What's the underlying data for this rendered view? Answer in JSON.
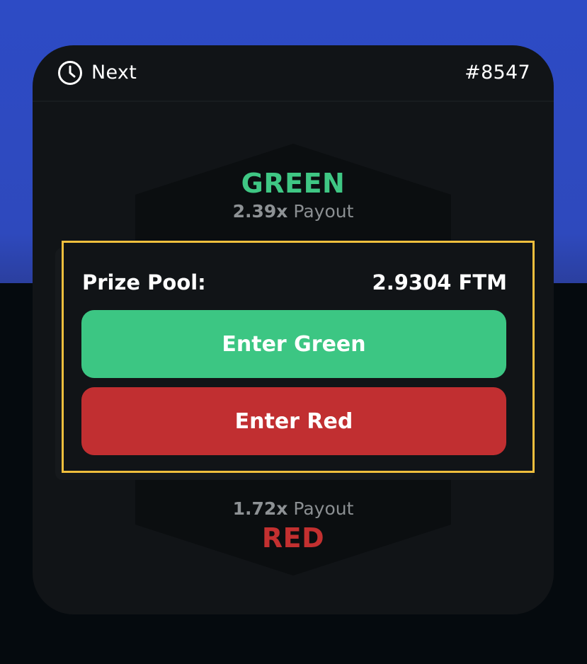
{
  "header": {
    "status_label": "Next",
    "round_id": "#8547",
    "status_icon": "clock-icon"
  },
  "green": {
    "title": "GREEN",
    "multiplier": "2.39x",
    "payout_label": "Payout",
    "color": "#3fc784"
  },
  "red": {
    "title": "RED",
    "multiplier": "1.72x",
    "payout_label": "Payout",
    "color": "#c33030"
  },
  "panel": {
    "prize_label": "Prize Pool:",
    "prize_value": "2.9304 FTM",
    "border_color": "#f0bf3d",
    "enter_green_label": "Enter Green",
    "enter_red_label": "Enter Red"
  },
  "colors": {
    "background_top": "#2d4bc5",
    "background_bottom": "#050a0e",
    "card": "#111417",
    "green_button": "#3cc683",
    "red_button": "#c12f31"
  }
}
